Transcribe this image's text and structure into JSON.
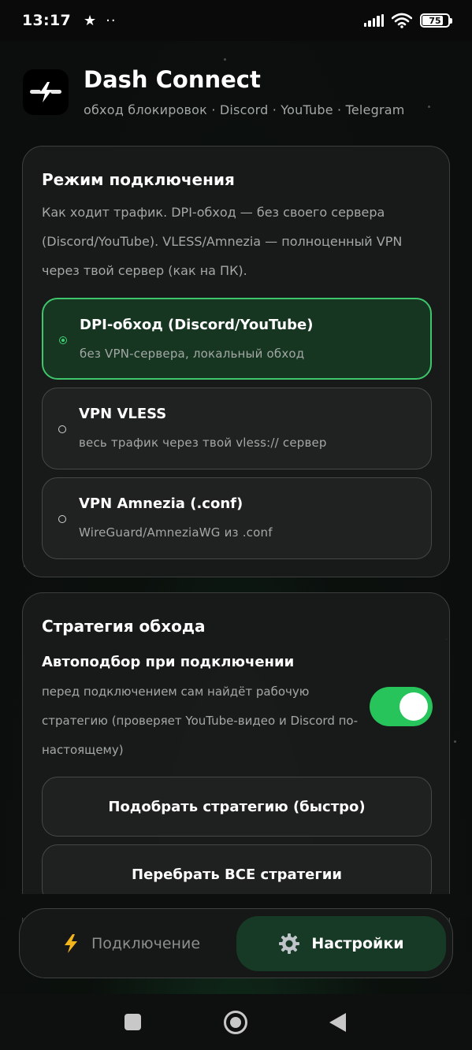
{
  "status_bar": {
    "time": "13:17",
    "star_icon": "★",
    "dots": "··",
    "battery": "75"
  },
  "header": {
    "app_title": "Dash Connect",
    "app_subtitle": "обход блокировок · Discord · YouTube · Telegram"
  },
  "connection_mode": {
    "title": "Режим подключения",
    "description": "Как ходит трафик. DPI-обход — без своего сервера (Discord/YouTube). VLESS/Amnezia — полноценный VPN через твой сервер (как на ПК).",
    "options": [
      {
        "title": "DPI-обход (Discord/YouTube)",
        "subtitle": "без VPN-сервера, локальный обход",
        "selected": true
      },
      {
        "title": "VPN VLESS",
        "subtitle": "весь трафик через твой vless:// сервер",
        "selected": false
      },
      {
        "title": "VPN Amnezia (.conf)",
        "subtitle": "WireGuard/AmneziaWG из .conf",
        "selected": false
      }
    ]
  },
  "strategy": {
    "title": "Стратегия обхода",
    "autopick_title": "Автоподбор при подключении",
    "autopick_desc": "перед подключением сам найдёт рабочую стратегию (проверяет YouTube-видео и Discord по-настоящему)",
    "autopick_enabled": true,
    "quick_button": "Подобрать стратегию (быстро)",
    "all_button": "Перебрать ВСЕ стратегии"
  },
  "bottom_nav": {
    "connection": "Подключение",
    "settings": "Настройки",
    "active": "settings"
  },
  "colors": {
    "accent_green": "#26c45a",
    "selected_bg": "#163622",
    "selected_border": "#3fc56b",
    "nav_active_bg": "#173a26"
  },
  "icons": {
    "logo": "lightning-logo-icon",
    "connection": "lightning-icon",
    "settings": "gear-icon"
  }
}
